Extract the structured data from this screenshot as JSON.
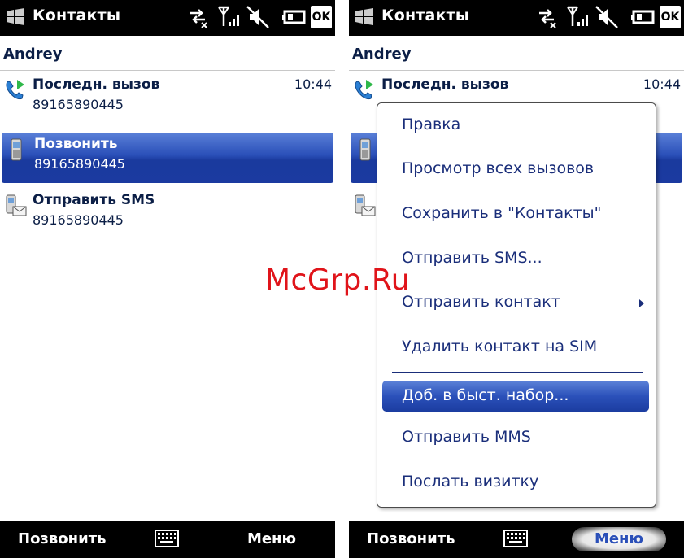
{
  "left": {
    "title": "Контакты",
    "ok_label": "OK",
    "contact_name": "Andrey",
    "items": [
      {
        "label": "Последн. вызов",
        "number": "89165890445",
        "time": "10:44",
        "icon": "phone-call-icon"
      },
      {
        "label": "Позвонить",
        "number": "89165890445",
        "icon": "mobile-phone-icon"
      },
      {
        "label": "Отправить SMS",
        "number": "89165890445",
        "icon": "sms-icon"
      }
    ],
    "soft_left": "Позвонить",
    "soft_right": "Меню"
  },
  "right": {
    "title": "Контакты",
    "ok_label": "OK",
    "contact_name": "Andrey",
    "first_item": {
      "label": "Последн. вызов",
      "time": "10:44"
    },
    "menu": {
      "items": [
        "Правка",
        "Просмотр всех вызовов",
        "Сохранить в \"Контакты\"",
        "Отправить SMS...",
        "Отправить контакт",
        "Удалить контакт на SIM"
      ],
      "highlighted": "Доб. в быст. набор...",
      "items_after": [
        "Отправить MMS",
        "Послать визитку"
      ]
    },
    "soft_left": "Позвонить",
    "soft_right": "Меню"
  },
  "watermark": "McGrp.Ru",
  "colors": {
    "accent": "#2a4fb8",
    "text": "#0b1e46",
    "menu_text": "#1a2e7a",
    "watermark": "#e0141a"
  }
}
